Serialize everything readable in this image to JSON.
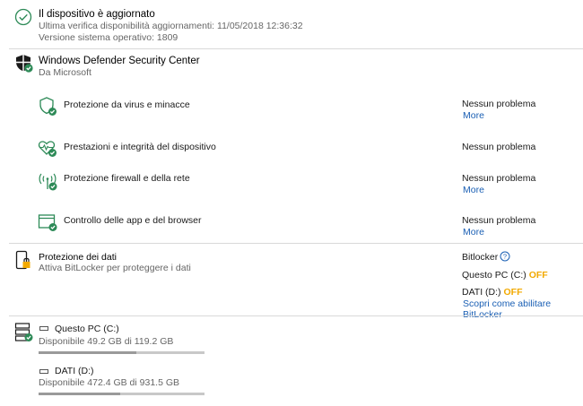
{
  "update": {
    "title": "Il dispositivo è aggiornato",
    "last_check": "Ultima verifica disponibilità aggiornamenti: 11/05/2018 12:36:32",
    "os_version": "Versione sistema operativo: 1809"
  },
  "defender": {
    "title": "Windows Defender Security Center",
    "publisher": "Da Microsoft",
    "items": [
      {
        "label": "Protezione da virus e minacce",
        "status": "Nessun problema",
        "link": "More"
      },
      {
        "label": "Prestazioni e integrità del dispositivo",
        "status": "Nessun problema",
        "link": ""
      },
      {
        "label": "Protezione firewall e della rete",
        "status": "Nessun problema",
        "link": "More"
      },
      {
        "label": "Controllo delle app e del browser",
        "status": "Nessun problema",
        "link": "More"
      }
    ]
  },
  "data_protection": {
    "title": "Protezione dei dati",
    "subtitle": "Attiva BitLocker per proteggere i dati",
    "bitlocker_label": "Bitlocker",
    "drive_c_label": "Questo PC (C:)",
    "drive_c_status": "OFF",
    "drive_d_label": "DATI (D:)",
    "drive_d_status": "OFF",
    "learn_link": "Scopri come abilitare BitLocker"
  },
  "storage": {
    "drives": [
      {
        "name": "Questo PC (C:)",
        "detail": "Disponibile 49.2 GB di 119.2 GB",
        "used_fraction": 0.587
      },
      {
        "name": "DATI (D:)",
        "detail": "Disponibile 472.4 GB di 931.5 GB",
        "used_fraction": 0.493
      }
    ]
  },
  "colors": {
    "accent_green": "#2d8a57",
    "link_blue": "#1a5fb4",
    "off_yellow": "#f2a900"
  }
}
